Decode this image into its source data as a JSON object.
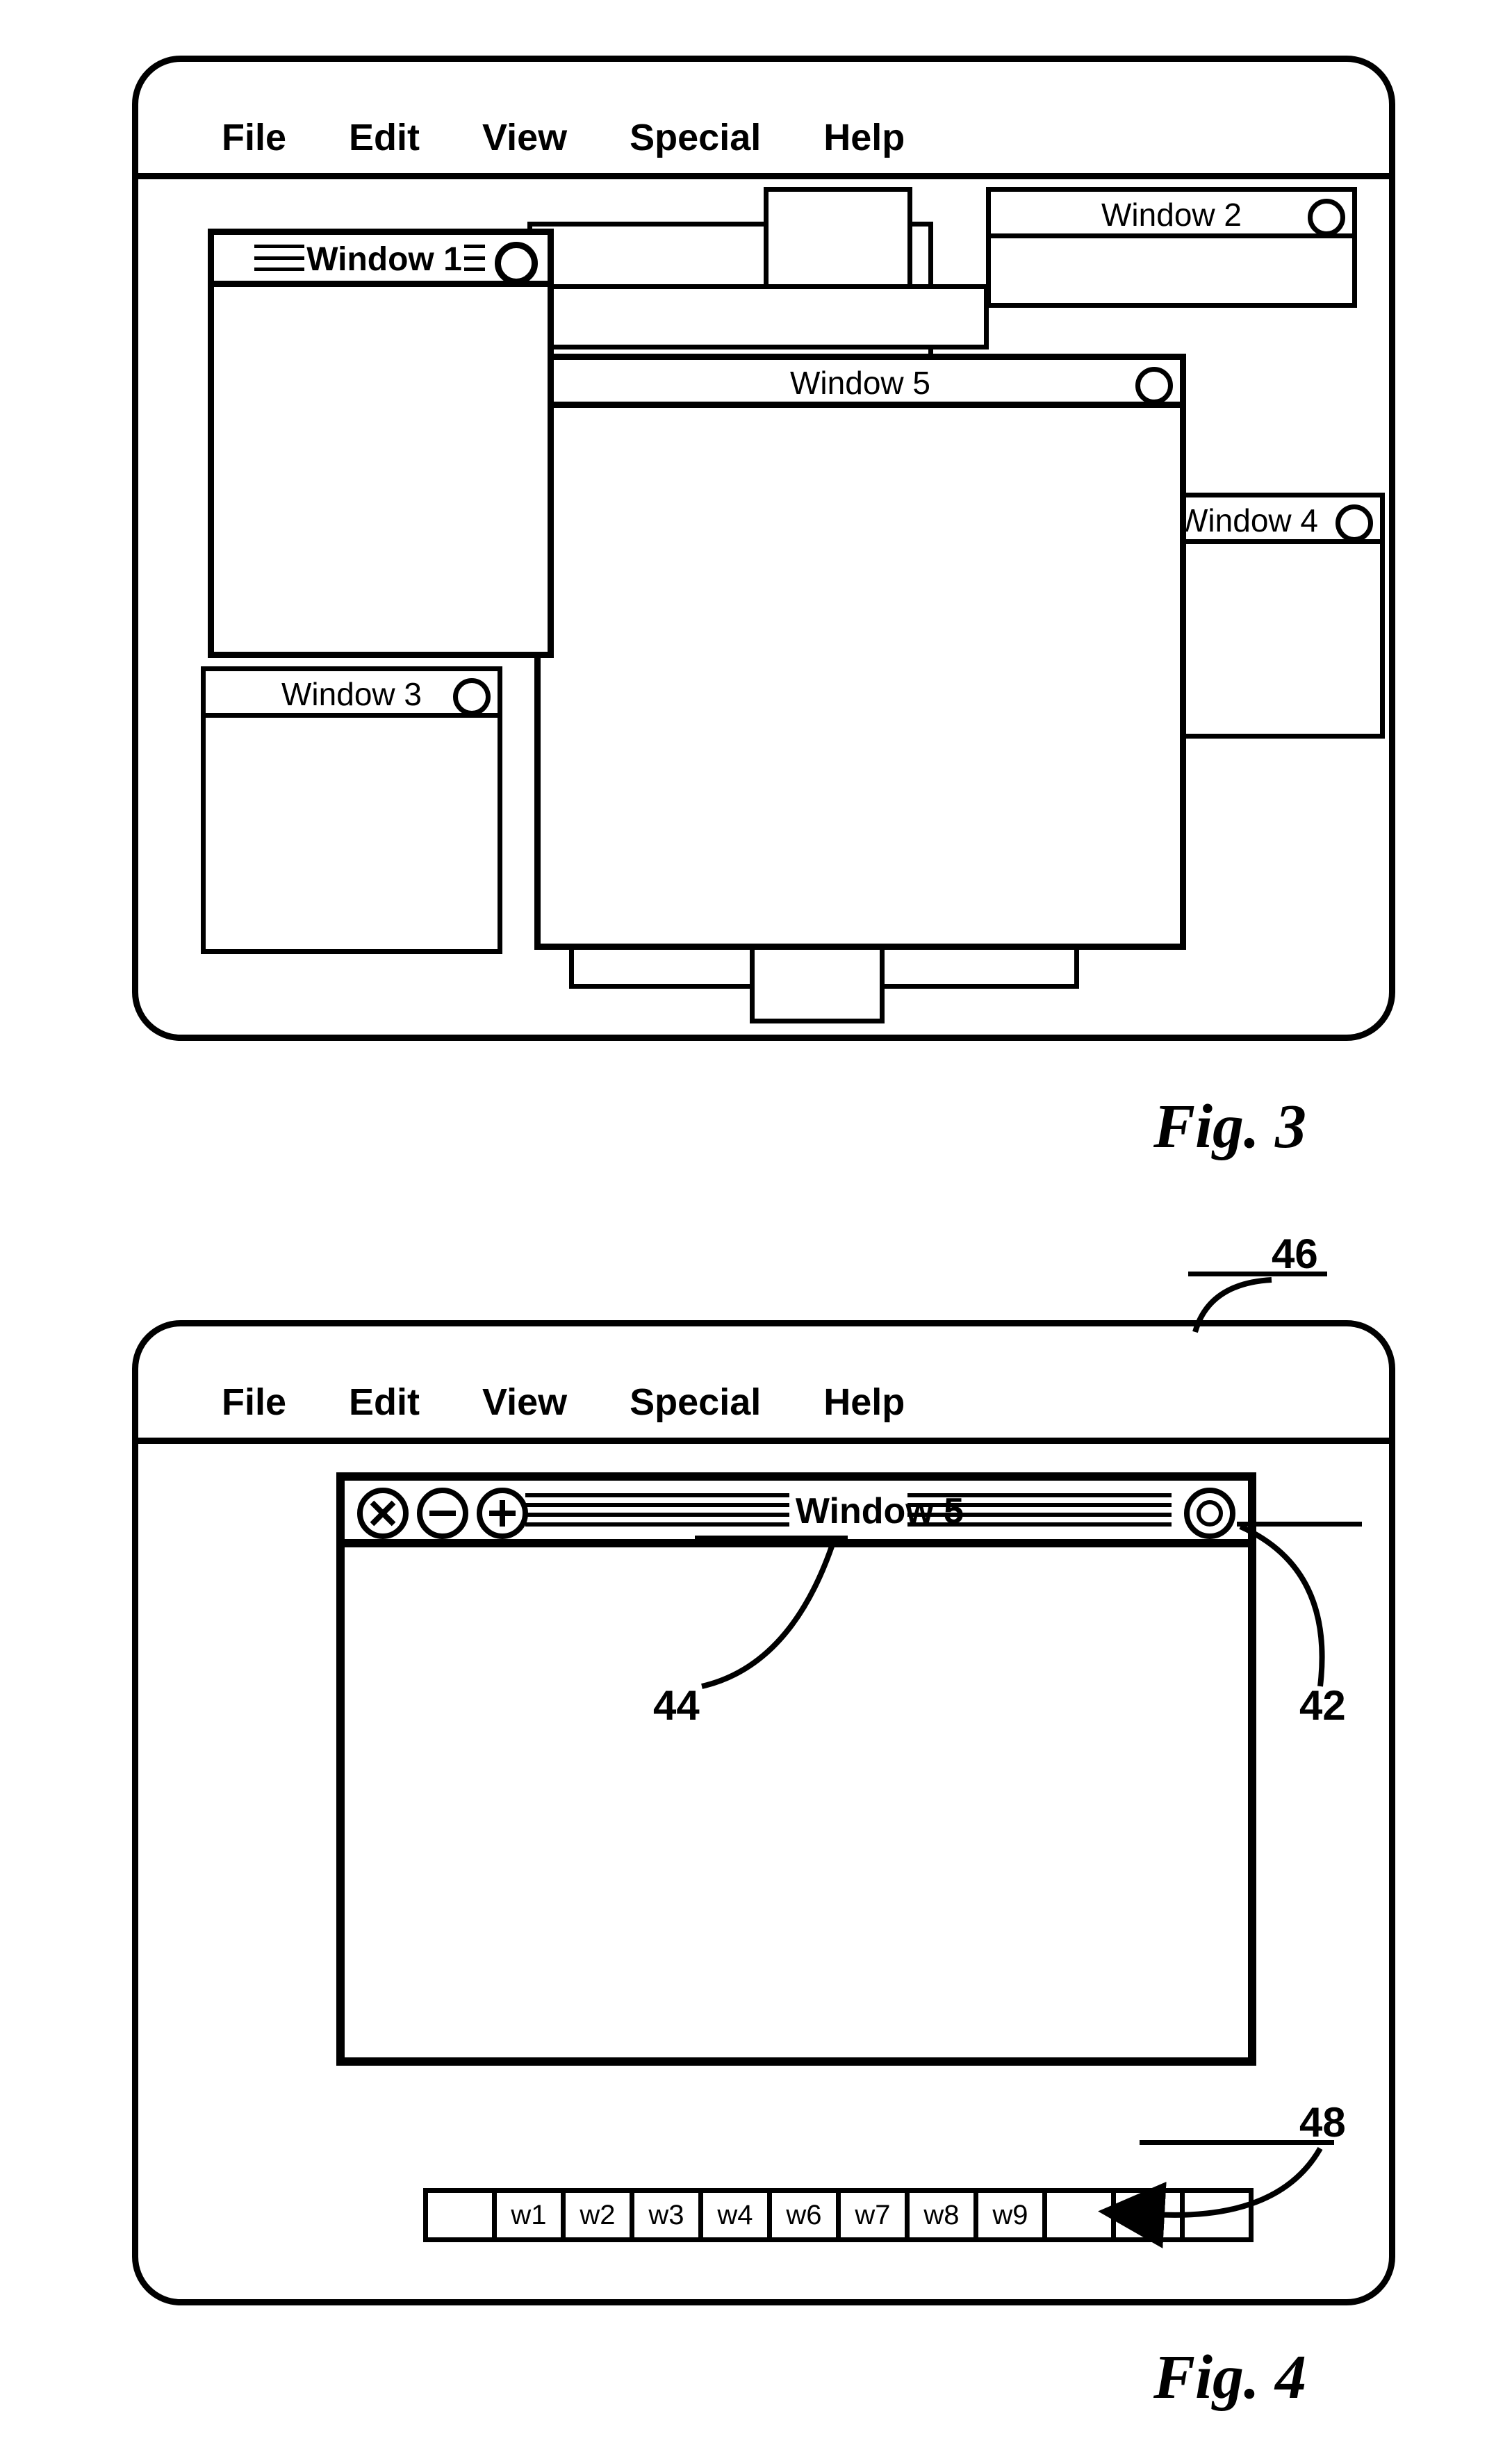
{
  "menus": [
    "File",
    "Edit",
    "View",
    "Special",
    "Help"
  ],
  "fig3": {
    "caption": "Fig. 3",
    "windows": {
      "w1": "Window 1",
      "w2": "Window 2",
      "w3": "Window 3",
      "w4": "Window 4",
      "w5": "Window 5"
    }
  },
  "fig4": {
    "caption": "Fig. 4",
    "window_title": "Window 5",
    "refs": {
      "screen": "46",
      "titlebar": "44",
      "zoom": "42",
      "taskbar": "48"
    },
    "taskbar": [
      "",
      "w1",
      "w2",
      "w3",
      "w4",
      "w6",
      "w7",
      "w8",
      "w9",
      "",
      "",
      ""
    ]
  }
}
